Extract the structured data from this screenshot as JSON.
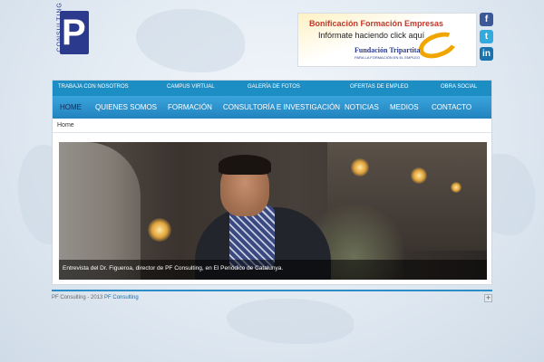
{
  "logo": {
    "letter": "P",
    "word": "CONSULTING"
  },
  "banner": {
    "line1": "Bonificación Formación Empresas",
    "line2": "Infórmate haciendo click aquí",
    "line3": "Fundación Tripartita",
    "line4": "PARA LA FORMACIÓN EN EL EMPLEO",
    "accent": "#f0a500"
  },
  "social": {
    "facebook": "f",
    "twitter": "t",
    "linkedin": "in"
  },
  "topbar": {
    "color": "#1c8ec4",
    "links": [
      "TRABAJA CON NOSOTROS",
      "CAMPUS VIRTUAL",
      "GALERÍA DE FOTOS",
      "OFERTAS DE EMPLEO",
      "OBRA SOCIAL"
    ]
  },
  "nav": {
    "color": "#2283be",
    "items": [
      "HOME",
      "QUIENES SOMOS",
      "FORMACIÓN",
      "CONSULTORÍA E INVESTIGACIÓN",
      "NOTICIAS",
      "MEDIOS",
      "CONTACTO"
    ]
  },
  "breadcrumb": "Home",
  "hero": {
    "caption": "Entrevista del Dr. Figueroa, director de PF Consulting, en El Periódico de Catalunya."
  },
  "footer": {
    "text": "PF Consulting - 2013 ",
    "link": "PF Consulting",
    "scroll_icon": "+"
  }
}
